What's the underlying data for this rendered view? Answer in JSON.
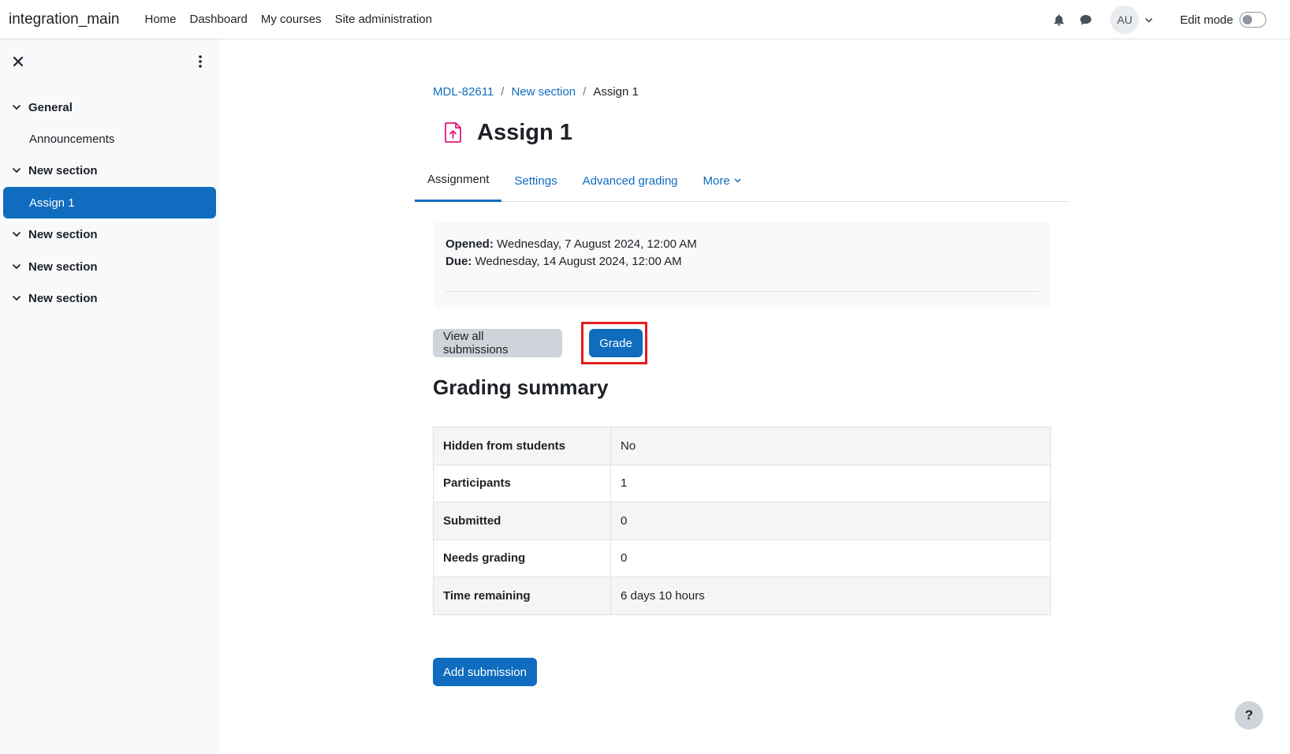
{
  "navbar": {
    "brand": "integration_main",
    "links": [
      "Home",
      "Dashboard",
      "My courses",
      "Site administration"
    ],
    "avatar_initials": "AU",
    "edit_mode_label": "Edit mode",
    "edit_mode_on": false
  },
  "sidebar": {
    "items": [
      {
        "type": "section",
        "label": "General"
      },
      {
        "type": "activity",
        "label": "Announcements"
      },
      {
        "type": "section",
        "label": "New section"
      },
      {
        "type": "activity",
        "label": "Assign 1",
        "active": true
      },
      {
        "type": "section",
        "label": "New section"
      },
      {
        "type": "section",
        "label": "New section"
      },
      {
        "type": "section",
        "label": "New section"
      }
    ]
  },
  "breadcrumb": [
    "MDL-82611",
    "New section",
    "Assign 1"
  ],
  "page_title": "Assign 1",
  "tabs": [
    {
      "label": "Assignment",
      "active": true
    },
    {
      "label": "Settings"
    },
    {
      "label": "Advanced grading"
    },
    {
      "label": "More"
    }
  ],
  "dates": {
    "opened_label": "Opened:",
    "opened_value": "Wednesday, 7 August 2024, 12:00 AM",
    "due_label": "Due:",
    "due_value": "Wednesday, 14 August 2024, 12:00 AM"
  },
  "actions": {
    "view_all": "View all submissions",
    "grade": "Grade",
    "add_submission": "Add submission"
  },
  "grading_summary": {
    "title": "Grading summary",
    "rows": [
      {
        "label": "Hidden from students",
        "value": "No"
      },
      {
        "label": "Participants",
        "value": "1"
      },
      {
        "label": "Submitted",
        "value": "0"
      },
      {
        "label": "Needs grading",
        "value": "0"
      },
      {
        "label": "Time remaining",
        "value": "6 days 10 hours"
      }
    ]
  },
  "help_label": "?",
  "colors": {
    "primary": "#0f6cbf",
    "highlight": "#e31d1d",
    "assign_icon": "#e2187d"
  },
  "icons": [
    "bell-icon",
    "chat-icon",
    "close-icon",
    "kebab-icon",
    "chevron-down-icon",
    "assignment-upload-icon"
  ]
}
